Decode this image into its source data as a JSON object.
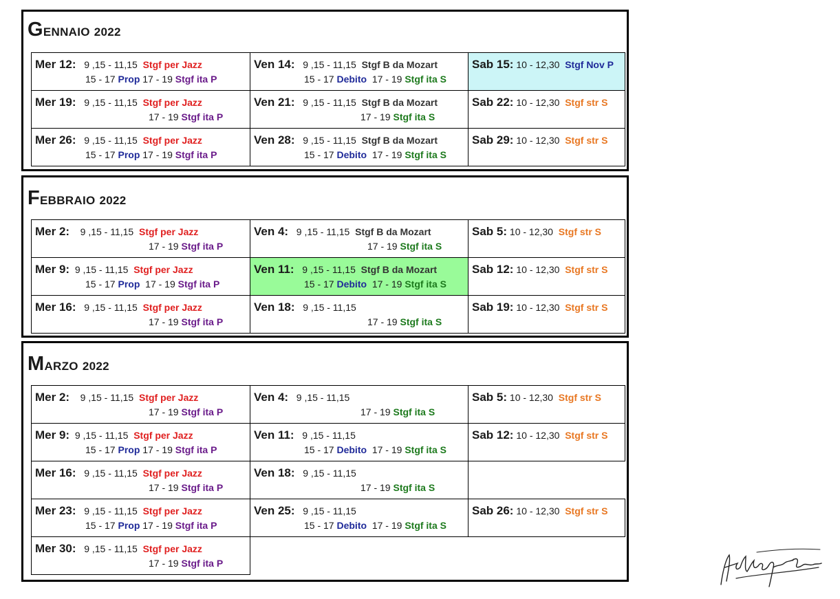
{
  "months": [
    {
      "cap": "G",
      "rest": "ENNAIO",
      "year": "2022",
      "cells": [
        {
          "day": "Mer 12:",
          "t1": "9 ,15 - 11,15",
          "s1": "Stgf  per Jazz",
          "l2a": "15 - 17",
          "p2": "Prop",
          "l2b": "17 - 19",
          "s2": "Stgf ita P"
        },
        {
          "day": "Ven 14:",
          "t1": "9 ,15 - 11,15",
          "s1": "Stgf  B da Mozart",
          "l2a": "15 - 17",
          "p2": "Debito",
          "l2b": "17 - 19",
          "s2": "Stgf ita S"
        },
        {
          "day": "Sab 15:",
          "t1": "10 - 12,30",
          "s1": "Stgf  Nov P"
        },
        {
          "day": "Mer 19:",
          "t1": "9 ,15 - 11,15",
          "s1": "Stgf  per Jazz",
          "l2b": "17 - 19",
          "s2": "Stgf ita P"
        },
        {
          "day": "Ven 21:",
          "t1": "9 ,15 - 11,15",
          "s1": "Stgf  B da Mozart",
          "l2b": "17 - 19",
          "s2": "Stgf ita S"
        },
        {
          "day": "Sab 22:",
          "t1": "10 - 12,30",
          "s1": "Stgf  str S"
        },
        {
          "day": "Mer 26:",
          "t1": "9 ,15 - 11,15",
          "s1": "Stgf  per Jazz",
          "l2a": "15 - 17",
          "p2": "Prop",
          "l2b": "17 - 19",
          "s2": "Stgf ita P"
        },
        {
          "day": "Ven 28:",
          "t1": "9 ,15 - 11,15",
          "s1": "Stgf  B da Mozart",
          "l2a": "15 - 17",
          "p2": "Debito",
          "l2b": "17 - 19",
          "s2": "Stgf ita S"
        },
        {
          "day": "Sab 29:",
          "t1": "10 - 12,30",
          "s1": "Stgf  str S"
        }
      ]
    },
    {
      "cap": "F",
      "rest": "EBBRAIO",
      "year": "2022",
      "cells": [
        {
          "day": "Mer 2:",
          "t1": "9 ,15 - 11,15",
          "s1": "Stgf  per Jazz",
          "l2b": "17 - 19",
          "s2": "Stgf ita P"
        },
        {
          "day": "Ven 4:",
          "t1": "9 ,15 - 11,15",
          "s1": "Stgf  B da Mozart",
          "l2b": "17 - 19",
          "s2": "Stgf ita S"
        },
        {
          "day": "Sab 5:",
          "t1": "10 - 12,30",
          "s1": "Stgf  str S"
        },
        {
          "day": "Mer 9:",
          "t1": "9 ,15 - 11,15",
          "s1": "Stgf  per Jazz",
          "l2a": "15 - 17",
          "p2": "Prop",
          "l2b": "17 - 19",
          "s2": "Stgf ita P"
        },
        {
          "day": "Ven 11:",
          "t1": "9 ,15 - 11,15",
          "s1": "Stgf  B da Mozart",
          "l2a": "15 - 17",
          "p2": "Debito",
          "l2b": "17 - 19",
          "s2": "Stgf ita S"
        },
        {
          "day": "Sab 12:",
          "t1": "10 - 12,30",
          "s1": "Stgf  str S"
        },
        {
          "day": "Mer 16:",
          "t1": "9 ,15 - 11,15",
          "s1": "Stgf  per Jazz",
          "l2b": "17 - 19",
          "s2": "Stgf ita P"
        },
        {
          "day": "Ven 18:",
          "t1": "9 ,15 - 11,15",
          "l2b": "17 - 19",
          "s2": "Stgf ita S"
        },
        {
          "day": "Sab 19:",
          "t1": "10 - 12,30",
          "s1": "Stgf  str S"
        }
      ]
    },
    {
      "cap": "M",
      "rest": "ARZO",
      "year": "2022",
      "cells": [
        {
          "day": "Mer 2:",
          "t1": "9 ,15 - 11,15",
          "s1": "Stgf  per Jazz",
          "l2b": "17 - 19",
          "s2": "Stgf ita P"
        },
        {
          "day": "Ven 4:",
          "t1": "9 ,15 - 11,15",
          "l2b": "17 - 19",
          "s2": "Stgf ita S"
        },
        {
          "day": "Sab 5:",
          "t1": "10 - 12,30",
          "s1": "Stgf  str S"
        },
        {
          "day": "Mer 9:",
          "t1": "9 ,15 - 11,15",
          "s1": "Stgf  per Jazz",
          "l2a": "15 - 17",
          "p2": "Prop",
          "l2b": "17 - 19",
          "s2": "Stgf ita P"
        },
        {
          "day": "Ven 11:",
          "t1": "9 ,15 - 11,15",
          "l2a": "15 - 17",
          "p2": "Debito",
          "l2b": "17 - 19",
          "s2": "Stgf ita S"
        },
        {
          "day": "Sab 12:",
          "t1": "10 - 12,30",
          "s1": "Stgf  str S"
        },
        {
          "day": "Mer 16:",
          "t1": "9 ,15 - 11,15",
          "s1": "Stgf  per Jazz",
          "l2b": "17 - 19",
          "s2": "Stgf ita P"
        },
        {
          "day": "Ven 18:",
          "t1": "9 ,15 - 11,15",
          "l2b": "17 - 19",
          "s2": "Stgf ita S"
        },
        {
          "day": "Mer 23:",
          "t1": "9 ,15 - 11,15",
          "s1": "Stgf  per Jazz",
          "l2a": "15 - 17",
          "p2": "Prop",
          "l2b": "17 - 19",
          "s2": "Stgf ita P"
        },
        {
          "day": "Ven 25:",
          "t1": "9 ,15 - 11,15",
          "l2a": "15 - 17",
          "p2": "Debito",
          "l2b": "17 - 19",
          "s2": "Stgf ita S"
        },
        {
          "day": "Sab 26:",
          "t1": "10 - 12,30",
          "s1": "Stgf  str S"
        },
        {
          "day": "Mer 30:",
          "t1": "9 ,15 - 11,15",
          "s1": "Stgf  per Jazz",
          "l2b": "17 - 19",
          "s2": "Stgf ita P"
        }
      ]
    }
  ],
  "colors": {
    "cyan_highlight": "#ccf5f7",
    "green_highlight": "#99fb99",
    "red": "#e02020",
    "purple": "#6a1b8a",
    "navy": "#1f2a99",
    "green": "#1d7a1d",
    "orange": "#e87722"
  }
}
